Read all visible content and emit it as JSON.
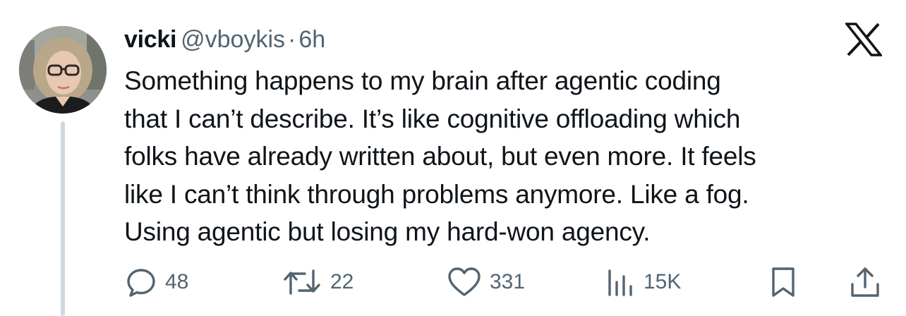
{
  "author": {
    "display_name": "vicki",
    "handle": "@vboykis",
    "separator": "·",
    "time": "6h"
  },
  "tweet": {
    "lines": [
      "Something happens to my brain after agentic coding",
      "that I can’t describe. It’s like cognitive offloading which",
      "folks have already written about, but even more. It feels",
      "like I can’t think through problems anymore. Like a fog.",
      "Using agentic but losing my hard-won agency."
    ]
  },
  "actions": {
    "replies": "48",
    "retweets": "22",
    "likes": "331",
    "views": "15K"
  },
  "icons": {
    "brand": "x-logo-icon",
    "reply": "speech-bubble-icon",
    "retweet": "retweet-arrows-icon",
    "like": "heart-icon",
    "views": "bar-chart-icon",
    "bookmark": "bookmark-icon",
    "share": "share-upload-icon"
  },
  "colors": {
    "text": "#0f1419",
    "secondary": "#536471",
    "thread_line": "#cfd9de"
  }
}
